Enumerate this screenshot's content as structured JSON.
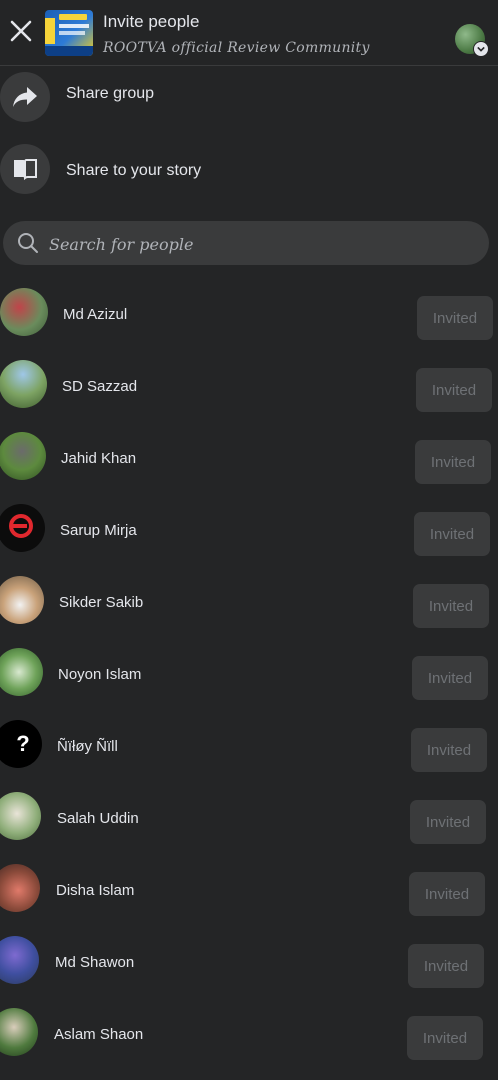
{
  "header": {
    "title": "Invite people",
    "subtitle": "ROOTVA official Review Community",
    "close_icon": "close-icon",
    "profile_icon": "profile-avatar"
  },
  "actions": [
    {
      "label": "Share group",
      "icon": "share-arrow-icon"
    },
    {
      "label": "Share to your story",
      "icon": "book-icon"
    }
  ],
  "search": {
    "placeholder": "Search for people"
  },
  "people": [
    {
      "name": "Md Azizul",
      "status": "Invited"
    },
    {
      "name": "SD Sazzad",
      "status": "Invited"
    },
    {
      "name": "Jahid Khan",
      "status": "Invited"
    },
    {
      "name": "Sarup Mirja",
      "status": "Invited"
    },
    {
      "name": "Sikder Sakib",
      "status": "Invited"
    },
    {
      "name": "Noyon Islam",
      "status": "Invited"
    },
    {
      "name": "Ñïłøy Ñïll",
      "status": "Invited"
    },
    {
      "name": "Salah Uddin",
      "status": "Invited"
    },
    {
      "name": "Disha Islam",
      "status": "Invited"
    },
    {
      "name": "Md Shawon",
      "status": "Invited"
    },
    {
      "name": "Aslam Shaon",
      "status": "Invited"
    }
  ],
  "colors": {
    "background": "#242526",
    "surface": "#3a3b3c",
    "text": "#e4e6eb",
    "muted_text": "#b0b3b8",
    "invited_text": "#6e7175"
  }
}
